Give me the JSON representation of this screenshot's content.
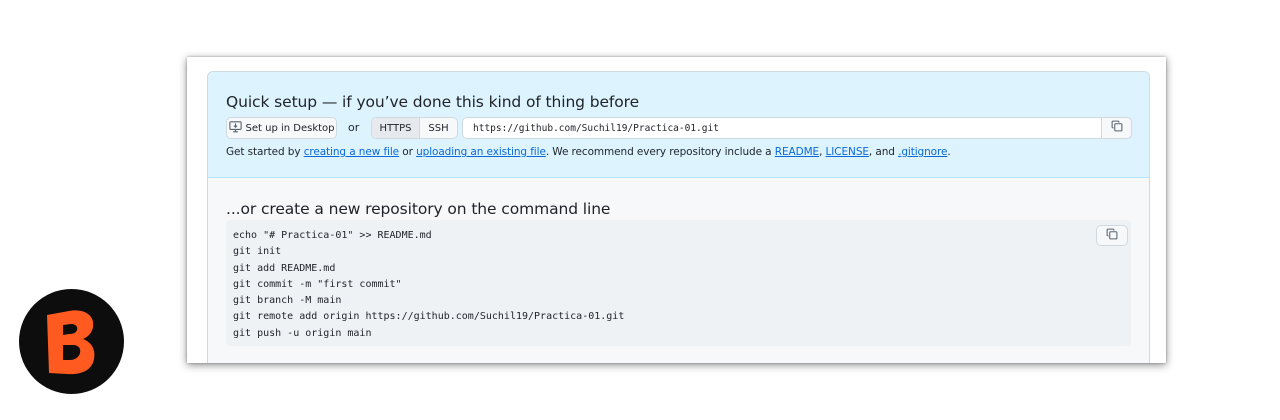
{
  "quick_setup": {
    "title": "Quick setup — if you’ve done this kind of thing before",
    "desktop_button": "Set up in Desktop",
    "or_label": "or",
    "protocols": [
      "HTTPS",
      "SSH"
    ],
    "selected_protocol": "HTTPS",
    "clone_url": "https://github.com/Suchil19/Practica-01.git",
    "description": {
      "prefix": "Get started by ",
      "link_create": "creating a new file",
      "or_text": " or ",
      "link_upload": "uploading an existing file",
      "middle": ". We recommend every repository include a ",
      "link_readme": "README",
      "comma1": ", ",
      "link_license": "LICENSE",
      "and_text": ", and ",
      "link_gitignore": ".gitignore",
      "suffix": "."
    }
  },
  "command_line": {
    "title": "...or create a new repository on the command line",
    "code_lines": [
      "echo \"# Practica-01\" >> README.md",
      "git init",
      "git add README.md",
      "git commit -m \"first commit\"",
      "git branch -M main",
      "git remote add origin https://github.com/Suchil19/Practica-01.git",
      "git push -u origin main"
    ]
  },
  "icons": {
    "desktop": "desktop-icon",
    "copy": "copy-icon",
    "logo": "brand-b-logo"
  },
  "colors": {
    "quick_bg": "#ddf4ff",
    "link": "#0969da",
    "logo_orange": "#ff5a1f",
    "logo_bg": "#0d0d0d"
  }
}
